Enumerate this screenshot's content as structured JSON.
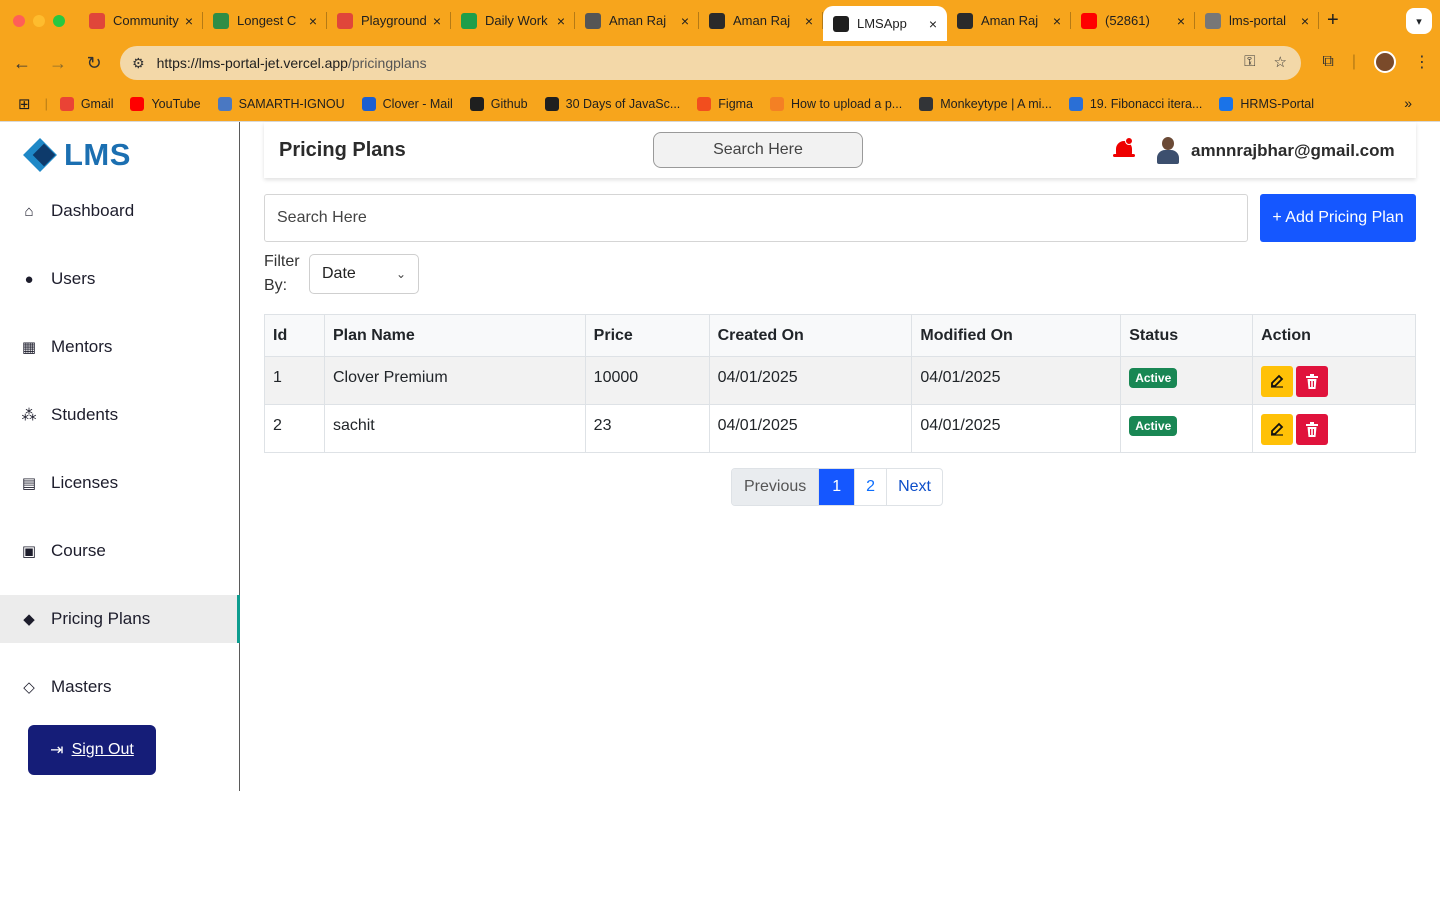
{
  "browser": {
    "tabs": [
      {
        "title": "Community",
        "favicon_color": "#e0463a",
        "active": false
      },
      {
        "title": "Longest C",
        "favicon_color": "#2f8d46",
        "active": false
      },
      {
        "title": "Playground",
        "favicon_color": "#e0463a",
        "active": false
      },
      {
        "title": "Daily Work",
        "favicon_color": "#1e9e4a",
        "active": false
      },
      {
        "title": "Aman Raj",
        "favicon_color": "#555555",
        "active": false
      },
      {
        "title": "Aman Raj",
        "favicon_color": "#2a2a2a",
        "active": false
      },
      {
        "title": "LMSApp",
        "favicon_color": "#1f1f1f",
        "active": true
      },
      {
        "title": "Aman Raj",
        "favicon_color": "#2a2a2a",
        "active": false
      },
      {
        "title": "(52861)",
        "favicon_color": "#ff0000",
        "active": false
      },
      {
        "title": "lms-portal",
        "favicon_color": "#777777",
        "active": false
      }
    ],
    "new_tab": "+",
    "url_host": "https://lms-portal-jet.vercel.app",
    "url_path": "/pricingplans",
    "bookmarks": [
      {
        "label": "Gmail",
        "color": "#ea4335"
      },
      {
        "label": "YouTube",
        "color": "#ff0000"
      },
      {
        "label": "SAMARTH-IGNOU",
        "color": "#4a78c2"
      },
      {
        "label": "Clover - Mail",
        "color": "#1c5fd1"
      },
      {
        "label": "Github",
        "color": "#1f1f1f"
      },
      {
        "label": "30 Days of JavaSc...",
        "color": "#1f1f1f"
      },
      {
        "label": "Figma",
        "color": "#f24e1e"
      },
      {
        "label": "How to upload a p...",
        "color": "#f48024"
      },
      {
        "label": "Monkeytype | A mi...",
        "color": "#323437"
      },
      {
        "label": "19. Fibonacci itera...",
        "color": "#2a6fd6"
      },
      {
        "label": "HRMS-Portal",
        "color": "#1a73e8"
      }
    ],
    "bookmarks_more": "»"
  },
  "app": {
    "logo_text": "LMS",
    "nav": [
      {
        "label": "Dashboard",
        "icon": "house-icon",
        "glyph": "⌂",
        "active": false
      },
      {
        "label": "Users",
        "icon": "user-icon",
        "glyph": "●",
        "active": false
      },
      {
        "label": "Mentors",
        "icon": "mentors-icon",
        "glyph": "▦",
        "active": false
      },
      {
        "label": "Students",
        "icon": "students-icon",
        "glyph": "⁂",
        "active": false
      },
      {
        "label": "Licenses",
        "icon": "license-icon",
        "glyph": "▤",
        "active": false
      },
      {
        "label": "Course",
        "icon": "course-icon",
        "glyph": "▣",
        "active": false
      },
      {
        "label": "Pricing Plans",
        "icon": "tag-icon",
        "glyph": "◆",
        "active": true
      },
      {
        "label": "Masters",
        "icon": "graduation-cap-icon",
        "glyph": "◇",
        "active": false
      }
    ],
    "sign_out": "Sign Out",
    "header": {
      "title": "Pricing Plans",
      "search_placeholder": "Search Here",
      "user_email": "amnnrajbhar@gmail.com"
    },
    "search_placeholder": "Search Here",
    "add_button": "+ Add Pricing Plan",
    "filter_label": "Filter By:",
    "filter_value": "Date",
    "table": {
      "columns": [
        "Id",
        "Plan Name",
        "Price",
        "Created On",
        "Modified On",
        "Status",
        "Action"
      ],
      "rows": [
        {
          "id": "1",
          "name": "Clover Premium",
          "price": "10000",
          "created": "04/01/2025",
          "modified": "04/01/2025",
          "status": "Active"
        },
        {
          "id": "2",
          "name": "sachit",
          "price": "23",
          "created": "04/01/2025",
          "modified": "04/01/2025",
          "status": "Active"
        }
      ]
    },
    "pagination": {
      "previous": "Previous",
      "pages": [
        "1",
        "2"
      ],
      "current": "1",
      "next": "Next"
    }
  }
}
